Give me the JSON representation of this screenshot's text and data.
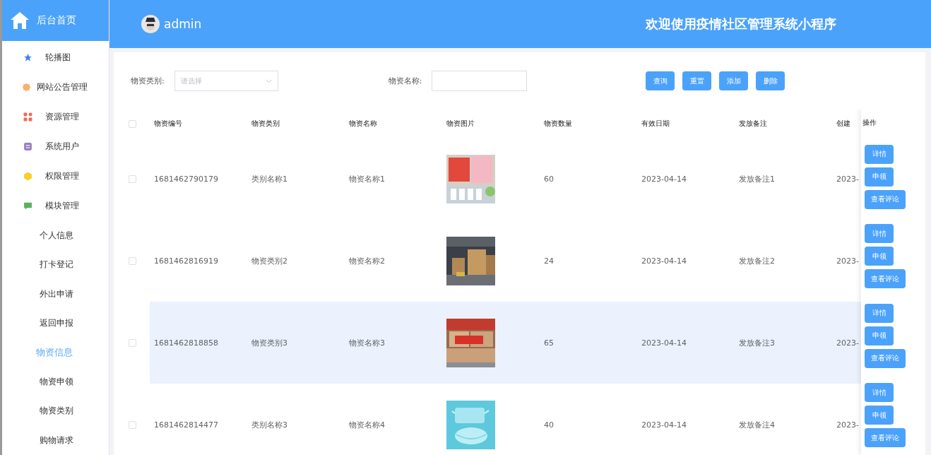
{
  "sidebar": {
    "home": "后台首页",
    "items": [
      {
        "label": "轮播图",
        "selected": false
      },
      {
        "label": "网站公告管理",
        "selected": false
      },
      {
        "label": "资源管理",
        "selected": false
      },
      {
        "label": "系统用户",
        "selected": false
      },
      {
        "label": "权限管理",
        "selected": false
      },
      {
        "label": "模块管理",
        "selected": false,
        "children": [
          {
            "label": "个人信息",
            "selected": false
          },
          {
            "label": "打卡登记",
            "selected": false
          },
          {
            "label": "外出申请",
            "selected": false
          },
          {
            "label": "返回申报",
            "selected": false
          },
          {
            "label": "物资信息",
            "selected": true
          },
          {
            "label": "物资申领",
            "selected": false
          },
          {
            "label": "物资类别",
            "selected": false
          },
          {
            "label": "购物请求",
            "selected": false
          }
        ]
      }
    ]
  },
  "header": {
    "user": "admin",
    "title": "欢迎使用疫情社区管理系统小程序"
  },
  "search": {
    "fields": [
      {
        "kind": "select",
        "label": "物资类别:",
        "placeholder": "请选择"
      },
      {
        "kind": "input",
        "label": "物资名称:"
      }
    ],
    "buttons": [
      "查询",
      "重置",
      "添加",
      "删除"
    ]
  },
  "table": {
    "all_checked": false,
    "columns": [
      "物资编号",
      "物资类别",
      "物资名称",
      "物资图片",
      "物资数量",
      "有效日期",
      "发放备注",
      "创建"
    ],
    "action_column": "操作",
    "rows": [
      {
        "checked": false,
        "highlighted": false,
        "cells": [
          "1681462790179",
          "类别名称1",
          "物资名称1",
          {
            "kind": "picture"
          },
          "60",
          "2023-04-14",
          "发放备注1",
          "2023-"
        ],
        "actions": [
          "详情",
          "申领",
          "查看评论"
        ]
      },
      {
        "checked": false,
        "highlighted": false,
        "cells": [
          "1681462816919",
          "物资类别2",
          "物资名称2",
          {
            "kind": "picture"
          },
          "24",
          "2023-04-14",
          "发放备注2",
          "2023-"
        ],
        "actions": [
          "详情",
          "申领",
          "查看评论"
        ]
      },
      {
        "checked": false,
        "highlighted": true,
        "cells": [
          "1681462818858",
          "物资类别3",
          "物资名称3",
          {
            "kind": "picture"
          },
          "65",
          "2023-04-14",
          "发放备注3",
          "2023-"
        ],
        "actions": [
          "详情",
          "申领",
          "查看评论"
        ]
      },
      {
        "checked": false,
        "highlighted": false,
        "cells": [
          "1681462814477",
          "类别名称3",
          "物资名称4",
          {
            "kind": "picture"
          },
          "40",
          "2023-04-14",
          "发放备注4",
          "2023-"
        ],
        "actions": [
          "详情",
          "申领",
          "查看评论"
        ]
      }
    ]
  }
}
